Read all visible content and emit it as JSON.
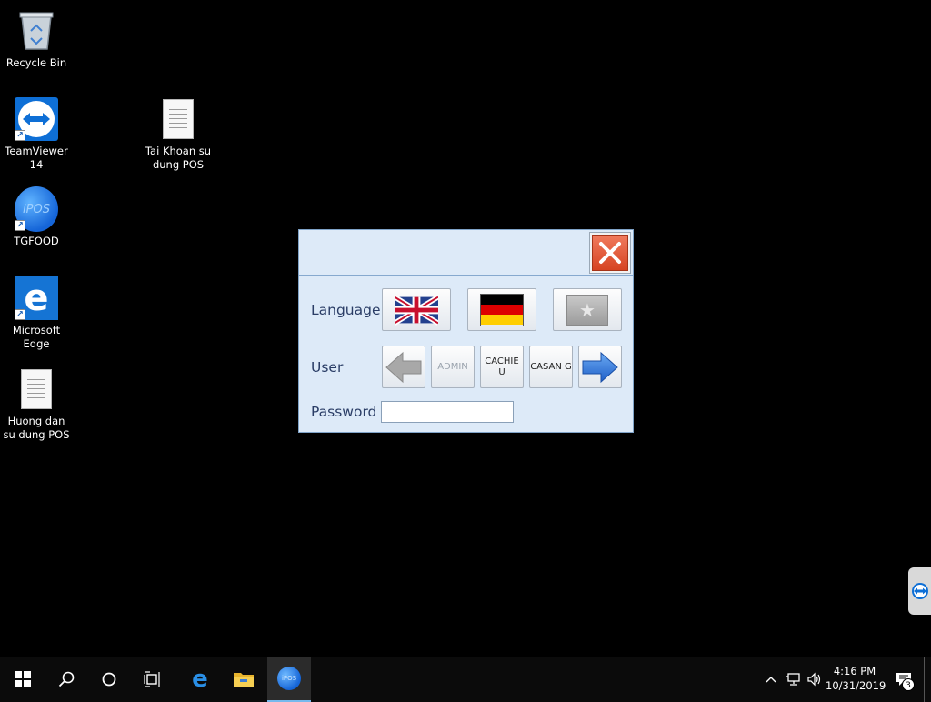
{
  "desktop": {
    "icons": [
      {
        "label": "Recycle Bin"
      },
      {
        "label": "TeamViewer 14"
      },
      {
        "label": "Tai Khoan su dung POS"
      },
      {
        "label": "TGFOOD"
      },
      {
        "label": "Microsoft Edge"
      },
      {
        "label": "Huong dan su dung POS"
      }
    ],
    "tgfood_logo_text": "iPOS"
  },
  "dialog": {
    "language_label": "Language",
    "user_label": "User",
    "password_label": "Password",
    "password_value": "",
    "users": [
      "ADMIN",
      "CACHIE U",
      "CASAN G"
    ],
    "accent": "#ddeaf8"
  },
  "taskbar": {
    "time": "4:16 PM",
    "date": "10/31/2019",
    "notification_count": "3",
    "pos_label": "iPOS"
  }
}
